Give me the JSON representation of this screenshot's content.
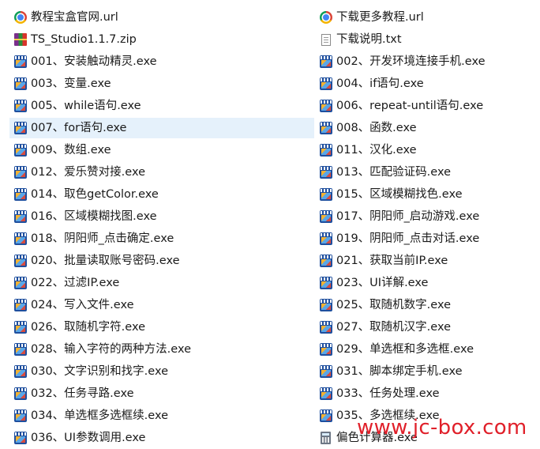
{
  "files": [
    {
      "left": {
        "name": "教程宝盒官网.url",
        "icon": "chrome-icon"
      },
      "right": {
        "name": "下载更多教程.url",
        "icon": "chrome-icon"
      }
    },
    {
      "left": {
        "name": "TS_Studio1.1.7.zip",
        "icon": "zip-icon"
      },
      "right": {
        "name": "下载说明.txt",
        "icon": "txt-icon"
      }
    },
    {
      "left": {
        "name": "001、安装触动精灵.exe",
        "icon": "exe-icon"
      },
      "right": {
        "name": "002、开发环境连接手机.exe",
        "icon": "exe-icon"
      }
    },
    {
      "left": {
        "name": "003、变量.exe",
        "icon": "exe-icon"
      },
      "right": {
        "name": "004、if语句.exe",
        "icon": "exe-icon"
      }
    },
    {
      "left": {
        "name": "005、while语句.exe",
        "icon": "exe-icon"
      },
      "right": {
        "name": "006、repeat-until语句.exe",
        "icon": "exe-icon"
      }
    },
    {
      "left": {
        "name": "007、for语句.exe",
        "icon": "exe-icon",
        "selected": true
      },
      "right": {
        "name": "008、函数.exe",
        "icon": "exe-icon"
      }
    },
    {
      "left": {
        "name": "009、数组.exe",
        "icon": "exe-icon"
      },
      "right": {
        "name": "011、汉化.exe",
        "icon": "exe-icon"
      }
    },
    {
      "left": {
        "name": "012、爱乐赞对接.exe",
        "icon": "exe-icon"
      },
      "right": {
        "name": "013、匹配验证码.exe",
        "icon": "exe-icon"
      }
    },
    {
      "left": {
        "name": "014、取色getColor.exe",
        "icon": "exe-icon"
      },
      "right": {
        "name": "015、区域模糊找色.exe",
        "icon": "exe-icon"
      }
    },
    {
      "left": {
        "name": "016、区域模糊找图.exe",
        "icon": "exe-icon"
      },
      "right": {
        "name": "017、阴阳师_启动游戏.exe",
        "icon": "exe-icon"
      }
    },
    {
      "left": {
        "name": "018、阴阳师_点击确定.exe",
        "icon": "exe-icon"
      },
      "right": {
        "name": "019、阴阳师_点击对话.exe",
        "icon": "exe-icon"
      }
    },
    {
      "left": {
        "name": "020、批量读取账号密码.exe",
        "icon": "exe-icon"
      },
      "right": {
        "name": "021、获取当前IP.exe",
        "icon": "exe-icon"
      }
    },
    {
      "left": {
        "name": "022、过滤IP.exe",
        "icon": "exe-icon"
      },
      "right": {
        "name": "023、UI详解.exe",
        "icon": "exe-icon"
      }
    },
    {
      "left": {
        "name": "024、写入文件.exe",
        "icon": "exe-icon"
      },
      "right": {
        "name": "025、取随机数字.exe",
        "icon": "exe-icon"
      }
    },
    {
      "left": {
        "name": "026、取随机字符.exe",
        "icon": "exe-icon"
      },
      "right": {
        "name": "027、取随机汉字.exe",
        "icon": "exe-icon"
      }
    },
    {
      "left": {
        "name": "028、输入字符的两种方法.exe",
        "icon": "exe-icon"
      },
      "right": {
        "name": "029、单选框和多选框.exe",
        "icon": "exe-icon"
      }
    },
    {
      "left": {
        "name": "030、文字识别和找字.exe",
        "icon": "exe-icon"
      },
      "right": {
        "name": "031、脚本绑定手机.exe",
        "icon": "exe-icon"
      }
    },
    {
      "left": {
        "name": "032、任务寻路.exe",
        "icon": "exe-icon"
      },
      "right": {
        "name": "033、任务处理.exe",
        "icon": "exe-icon"
      }
    },
    {
      "left": {
        "name": "034、单选框多选框续.exe",
        "icon": "exe-icon"
      },
      "right": {
        "name": "035、多选框续.exe",
        "icon": "exe-icon"
      }
    },
    {
      "left": {
        "name": "036、UI参数调用.exe",
        "icon": "exe-icon"
      },
      "right": {
        "name": "偏色计算器.exe",
        "icon": "calculator-icon"
      }
    }
  ],
  "watermark": "www.jc-box.com"
}
